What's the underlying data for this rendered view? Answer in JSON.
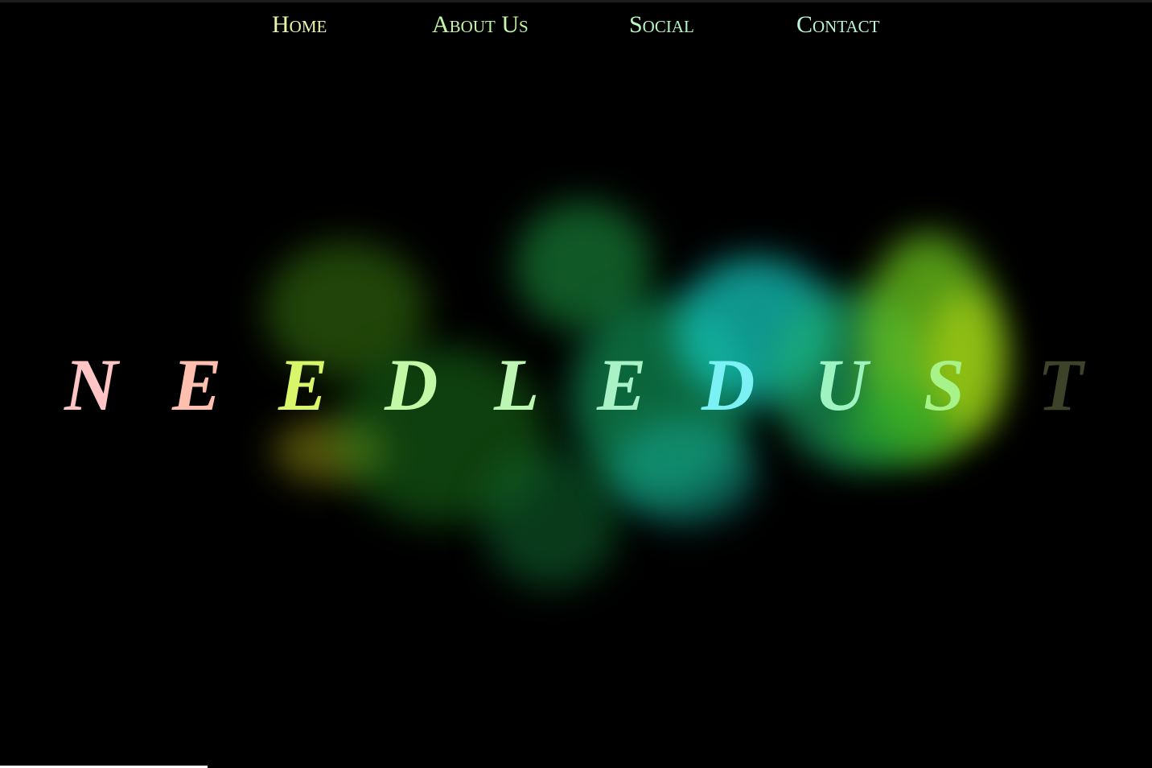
{
  "nav": {
    "items": [
      {
        "label": "Home"
      },
      {
        "label": "About Us"
      },
      {
        "label": "Social"
      },
      {
        "label": "Contact"
      }
    ]
  },
  "hero": {
    "title": "NEEDLEDUST",
    "letters": [
      "N",
      "E",
      "E",
      "D",
      "L",
      "E",
      "D",
      "U",
      "S",
      "T"
    ],
    "letter_colors": [
      "#ffc4c4",
      "#ffbfae",
      "#d9f56a",
      "#c2f8a6",
      "#bdf5b3",
      "#a9f2c7",
      "#7cf1f5",
      "#9ef3c0",
      "#a8f28a",
      "#6e7a4a"
    ]
  }
}
